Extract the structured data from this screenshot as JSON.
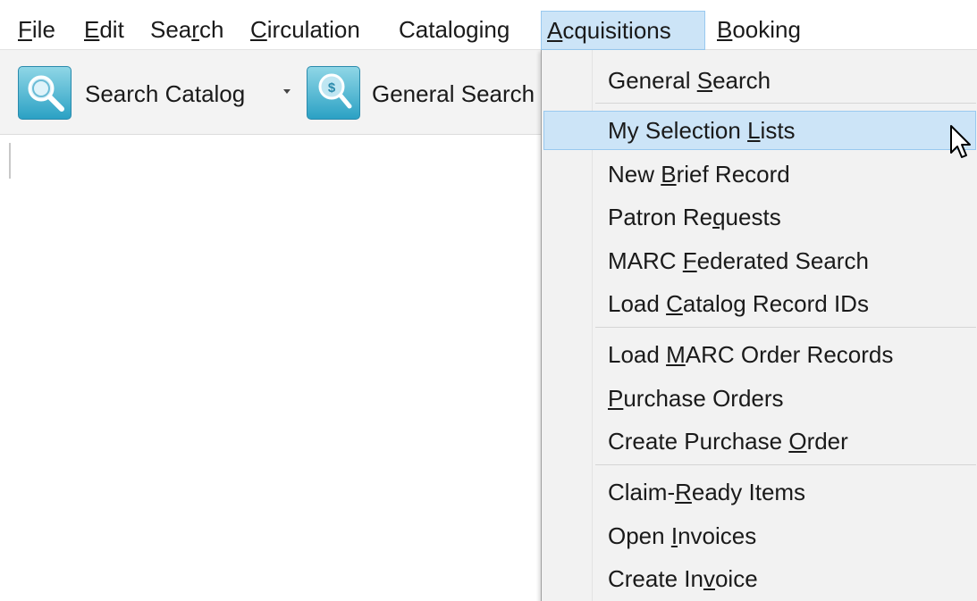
{
  "menubar": {
    "items": [
      {
        "pre": "",
        "key": "F",
        "post": "ile"
      },
      {
        "pre": "",
        "key": "E",
        "post": "dit"
      },
      {
        "pre": "Sea",
        "key": "r",
        "post": "ch"
      },
      {
        "pre": "",
        "key": "C",
        "post": "irculation"
      },
      {
        "pre": "Catalo",
        "key": "g",
        "post": "ing"
      },
      {
        "pre": "",
        "key": "A",
        "post": "cquisitions"
      },
      {
        "pre": "",
        "key": "B",
        "post": "ooking"
      }
    ],
    "active_item": "Acquisitions"
  },
  "toolbar": {
    "search_catalog_label": "Search Catalog",
    "search_catalog_icon": "magnifier-icon",
    "general_search_label": "General Search",
    "general_search_icon": "money-magnifier-icon"
  },
  "dropdown": {
    "items": [
      {
        "pre": "General ",
        "key": "S",
        "post": "earch"
      },
      {
        "pre": "My Selection ",
        "key": "L",
        "post": "ists"
      },
      {
        "pre": "New ",
        "key": "B",
        "post": "rief Record"
      },
      {
        "pre": "Patron Re",
        "key": "q",
        "post": "uests"
      },
      {
        "pre": "MARC ",
        "key": "F",
        "post": "ederated Search"
      },
      {
        "pre": "Load ",
        "key": "C",
        "post": "atalog Record IDs"
      },
      {
        "pre": "Load ",
        "key": "M",
        "post": "ARC Order Records"
      },
      {
        "pre": "",
        "key": "P",
        "post": "urchase Orders"
      },
      {
        "pre": "Create Purchase ",
        "key": "O",
        "post": "rder"
      },
      {
        "pre": "Claim-",
        "key": "R",
        "post": "eady Items"
      },
      {
        "pre": "Open ",
        "key": "I",
        "post": "nvoices"
      },
      {
        "pre": "Create In",
        "key": "v",
        "post": "oice"
      }
    ],
    "hovered_item": "My Selection Lists"
  },
  "colors": {
    "highlight": "#cce4f7",
    "highlight_border": "#99c9ef",
    "menu_bg": "#f2f2f2",
    "toolbar_bg": "#f3f3f3",
    "icon_teal": "#2ba1c4"
  }
}
